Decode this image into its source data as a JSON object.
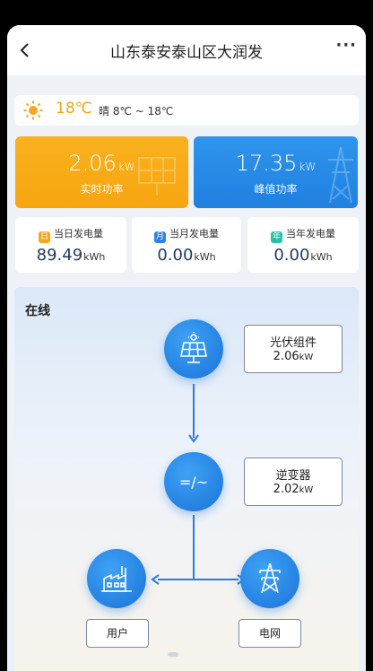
{
  "header": {
    "title": "山东泰安泰山区大润发",
    "more": "···"
  },
  "weather": {
    "temperature": "18℃",
    "description": "晴 8℃ ~ 18℃"
  },
  "realtime_power": {
    "value": "2.06",
    "unit": "kW",
    "label": "实时功率"
  },
  "peak_power": {
    "value": "17.35",
    "unit": "kW",
    "label": "峰值功率"
  },
  "energy": [
    {
      "label": "当日发电量",
      "value": "89.49",
      "unit": "kWh",
      "color": "#f5a623"
    },
    {
      "label": "当月发电量",
      "value": "0.00",
      "unit": "kWh",
      "color": "#2f80ed"
    },
    {
      "label": "当年发电量",
      "value": "0.00",
      "unit": "kWh",
      "color": "#27c2a3"
    }
  ],
  "flow": {
    "status": "在线",
    "pv": {
      "label": "光伏组件",
      "value": "2.06",
      "unit": "kW"
    },
    "inverter": {
      "label": "逆变器",
      "value": "2.02",
      "unit": "kW",
      "symbol": "=/~"
    },
    "user": {
      "label": "用户"
    },
    "grid": {
      "label": "电网"
    }
  },
  "colors": {
    "accent": "#1f80e0",
    "orange": "#f7a50f",
    "sun": "#f5a623"
  }
}
